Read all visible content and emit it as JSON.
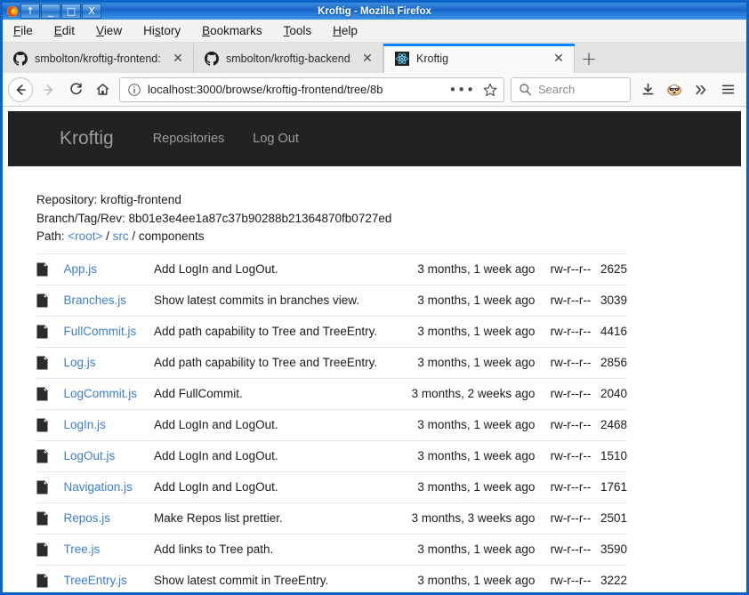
{
  "window": {
    "title": "Kroftig - Mozilla Firefox",
    "controls": {
      "shade": "↑",
      "minimize": "_",
      "maximize": "□",
      "close": "X"
    }
  },
  "menubar": [
    {
      "name": "file",
      "pre": "",
      "key": "F",
      "post": "ile"
    },
    {
      "name": "edit",
      "pre": "",
      "key": "E",
      "post": "dit"
    },
    {
      "name": "view",
      "pre": "",
      "key": "V",
      "post": "iew"
    },
    {
      "name": "history",
      "pre": "Hi",
      "key": "s",
      "post": "tory"
    },
    {
      "name": "bookmarks",
      "pre": "",
      "key": "B",
      "post": "ookmarks"
    },
    {
      "name": "tools",
      "pre": "",
      "key": "T",
      "post": "ools"
    },
    {
      "name": "help",
      "pre": "",
      "key": "H",
      "post": "elp"
    }
  ],
  "tabs": [
    {
      "label": "smbolton/kroftig-frontend:",
      "favicon": "github-icon",
      "active": false
    },
    {
      "label": "smbolton/kroftig-backend:",
      "favicon": "github-icon",
      "active": false
    },
    {
      "label": "Kroftig",
      "favicon": "react-icon",
      "active": true
    }
  ],
  "newtab_label": "+",
  "toolbar": {
    "back": "back-arrow",
    "forward": "forward-arrow",
    "reload": "reload-icon",
    "home": "home-icon",
    "url_value": "localhost:3000/browse/kroftig-frontend/tree/8b",
    "page_actions": "•••",
    "bookmark": "star-icon",
    "search_placeholder": "Search",
    "downloads": "download-icon",
    "privacy_badger": "badger-icon",
    "overflow": "»",
    "menu": "hamburger-icon"
  },
  "page": {
    "brand": "Kroftig",
    "navlinks": [
      {
        "name": "repositories",
        "label": "Repositories"
      },
      {
        "name": "logout",
        "label": "Log Out"
      }
    ],
    "repository_line": "Repository: kroftig-frontend",
    "revision_line": "Branch/Tag/Rev: 8b01e3e4ee1a87c37b90288b21364870fb0727ed",
    "path": {
      "label": "Path:",
      "segments": [
        {
          "text": "<root>",
          "link": true
        },
        {
          "text": "/",
          "link": false
        },
        {
          "text": "src",
          "link": true
        },
        {
          "text": "/",
          "link": false
        },
        {
          "text": "components",
          "link": false
        }
      ]
    },
    "files": [
      {
        "name": "App.js",
        "message": "Add LogIn and LogOut.",
        "age": "3 months, 1 week ago",
        "perms": "rw-r--r--",
        "size": "2625"
      },
      {
        "name": "Branches.js",
        "message": "Show latest commits in branches view.",
        "age": "3 months, 1 week ago",
        "perms": "rw-r--r--",
        "size": "3039"
      },
      {
        "name": "FullCommit.js",
        "message": "Add path capability to Tree and TreeEntry.",
        "age": "3 months, 1 week ago",
        "perms": "rw-r--r--",
        "size": "4416"
      },
      {
        "name": "Log.js",
        "message": "Add path capability to Tree and TreeEntry.",
        "age": "3 months, 1 week ago",
        "perms": "rw-r--r--",
        "size": "2856"
      },
      {
        "name": "LogCommit.js",
        "message": "Add FullCommit.",
        "age": "3 months, 2 weeks ago",
        "perms": "rw-r--r--",
        "size": "2040"
      },
      {
        "name": "LogIn.js",
        "message": "Add LogIn and LogOut.",
        "age": "3 months, 1 week ago",
        "perms": "rw-r--r--",
        "size": "2468"
      },
      {
        "name": "LogOut.js",
        "message": "Add LogIn and LogOut.",
        "age": "3 months, 1 week ago",
        "perms": "rw-r--r--",
        "size": "1510"
      },
      {
        "name": "Navigation.js",
        "message": "Add LogIn and LogOut.",
        "age": "3 months, 1 week ago",
        "perms": "rw-r--r--",
        "size": "1761"
      },
      {
        "name": "Repos.js",
        "message": "Make Repos list prettier.",
        "age": "3 months, 3 weeks ago",
        "perms": "rw-r--r--",
        "size": "2501"
      },
      {
        "name": "Tree.js",
        "message": "Add links to Tree path.",
        "age": "3 months, 1 week ago",
        "perms": "rw-r--r--",
        "size": "3590"
      },
      {
        "name": "TreeEntry.js",
        "message": "Show latest commit in TreeEntry.",
        "age": "3 months, 1 week ago",
        "perms": "rw-r--r--",
        "size": "3222"
      }
    ]
  },
  "colors": {
    "titlebar_blue": "#1663c4",
    "window_border": "#0a64c8",
    "navbar_dark": "#222222",
    "link_blue": "#3d7dc4",
    "tab_accent": "#0a84ff"
  }
}
